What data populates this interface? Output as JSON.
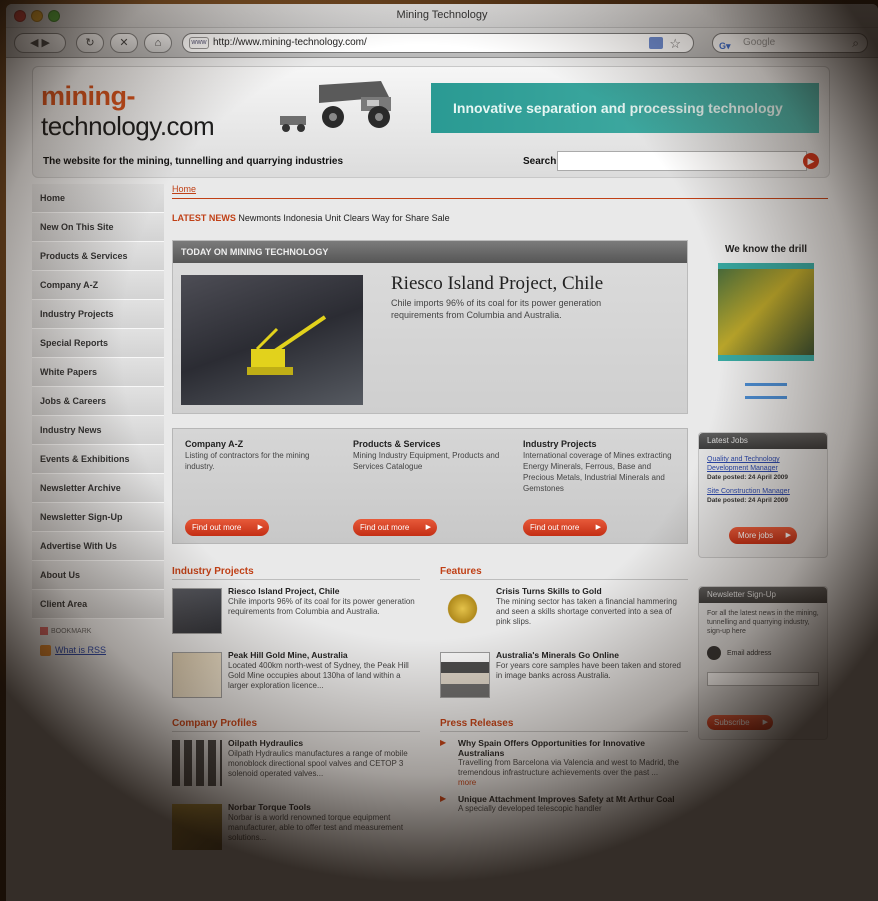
{
  "window": {
    "title": "Mining Technology"
  },
  "toolbar": {
    "url": "http://www.mining-technology.com/",
    "search_placeholder": "Google",
    "url_icon": "globe-icon"
  },
  "header": {
    "logo_top": "mining-",
    "logo_bottom": "technology.com",
    "banner": "Innovative separation and processing technology",
    "tagline": "The website for the mining, tunnelling and quarrying industries",
    "search_label": "Search"
  },
  "sidebar": {
    "items": [
      "Home",
      "New On This Site",
      "Products & Services",
      "Company A-Z",
      "Industry Projects",
      "Special Reports",
      "White Papers",
      "Jobs & Careers",
      "Industry News",
      "Events & Exhibitions",
      "Newsletter Archive",
      "Newsletter Sign-Up",
      "Advertise With Us",
      "About Us",
      "Client Area"
    ],
    "bookmark": "BOOKMARK",
    "rss": "What is RSS"
  },
  "main": {
    "breadcrumb": "Home",
    "latest_label": "LATEST NEWS",
    "latest_text": "Newmonts Indonesia Unit Clears Way for Share Sale",
    "today_head": "TODAY ON MINING TECHNOLOGY",
    "today_title": "Riesco Island Project, Chile",
    "today_desc": "Chile imports 96% of its coal for its power generation requirements from Columbia and Australia.",
    "cols": [
      {
        "title": "Company A-Z",
        "desc": "Listing of contractors for the mining industry.",
        "button": "Find out more"
      },
      {
        "title": "Products & Services",
        "desc": "Mining Industry Equipment, Products and Services Catalogue",
        "button": "Find out more"
      },
      {
        "title": "Industry Projects",
        "desc": "International coverage of Mines extracting Energy Minerals, Ferrous, Base and Precious Metals, Industrial Minerals and Gemstones",
        "button": "Find out more"
      }
    ]
  },
  "ad": {
    "title": "We know the drill"
  },
  "jobs": {
    "head": "Latest Jobs",
    "items": [
      {
        "title": "Quality and Technology Development Manager",
        "date": "Date posted: 24 April 2009"
      },
      {
        "title": "Site Construction Manager",
        "date": "Date posted: 24 April 2009"
      }
    ],
    "more": "More jobs"
  },
  "newsletter": {
    "head": "Newsletter Sign-Up",
    "text": "For all the latest news in the mining, tunnelling and quarrying industry, sign-up here",
    "email_label": "Email address",
    "subscribe": "Subscribe"
  },
  "industry_projects": {
    "head": "Industry Projects",
    "items": [
      {
        "title": "Riesco Island Project, Chile",
        "desc": "Chile imports 96% of its coal for its power generation requirements from Columbia and Australia."
      },
      {
        "title": "Peak Hill Gold Mine, Australia",
        "desc": "Located 400km north-west of Sydney, the Peak Hill Gold Mine occupies about 130ha of land within a larger exploration licence..."
      }
    ]
  },
  "features": {
    "head": "Features",
    "items": [
      {
        "title": "Crisis Turns Skills to Gold",
        "desc": "The mining sector has taken a financial hammering and seen a skills shortage converted into a sea of pink slips."
      },
      {
        "title": "Australia's Minerals Go Online",
        "desc": "For years core samples have been taken and stored in image banks across Australia."
      }
    ]
  },
  "company_profiles": {
    "head": "Company Profiles",
    "items": [
      {
        "title": "Oilpath Hydraulics",
        "desc": "Oilpath Hydraulics manufactures a range of mobile monoblock directional spool valves and CETOP 3 solenoid operated valves..."
      },
      {
        "title": "Norbar Torque Tools",
        "desc": "Norbar is a world renowned torque equipment manufacturer, able to offer test and measurement solutions..."
      }
    ]
  },
  "press_releases": {
    "head": "Press Releases",
    "items": [
      {
        "title": "Why Spain Offers Opportunities for Innovative Australians",
        "desc": "Travelling from Barcelona via Valencia and west to Madrid, the tremendous infrastructure achievements over the past ...",
        "more": "more"
      },
      {
        "title": "Unique Attachment Improves Safety at Mt Arthur Coal",
        "desc": "A specially developed telescopic handler"
      }
    ]
  }
}
